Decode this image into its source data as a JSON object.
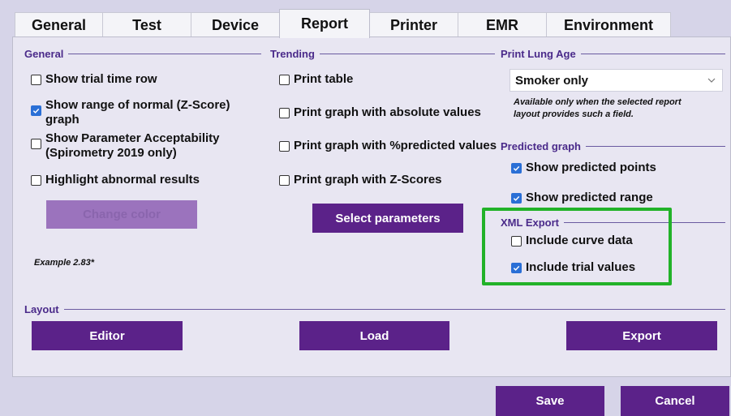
{
  "tabs": [
    {
      "label": "General"
    },
    {
      "label": "Test"
    },
    {
      "label": "Device"
    },
    {
      "label": "Report",
      "active": true
    },
    {
      "label": "Printer"
    },
    {
      "label": "EMR"
    },
    {
      "label": "Environment"
    }
  ],
  "sections": {
    "general": "General",
    "trending": "Trending",
    "print_lung_age": "Print Lung Age",
    "predicted_graph": "Predicted graph",
    "xml_export": "XML Export",
    "layout": "Layout"
  },
  "general": {
    "show_trial_time_row": {
      "label": "Show trial time row",
      "checked": false
    },
    "show_range_of_normal": {
      "label": "Show range of normal (Z-Score) graph",
      "checked": true
    },
    "show_parameter_acceptability": {
      "label": "Show Parameter Acceptability (Spirometry 2019 only)",
      "checked": false
    },
    "highlight_abnormal": {
      "label": "Highlight abnormal results",
      "checked": false
    },
    "change_color_label": "Change color",
    "example_text": "Example 2.83*"
  },
  "trending": {
    "print_table": {
      "label": "Print table",
      "checked": false
    },
    "print_graph_absolute": {
      "label": "Print graph with absolute values",
      "checked": false
    },
    "print_graph_predicted": {
      "label": "Print graph with %predicted values",
      "checked": false
    },
    "print_graph_zscores": {
      "label": "Print graph with Z-Scores",
      "checked": false
    },
    "select_parameters_label": "Select parameters"
  },
  "print_lung_age": {
    "selected": "Smoker only",
    "note": "Available only when the selected report layout provides such a field."
  },
  "predicted_graph": {
    "show_points": {
      "label": "Show predicted points",
      "checked": true
    },
    "show_range": {
      "label": "Show predicted range",
      "checked": true
    }
  },
  "xml_export": {
    "include_curve_data": {
      "label": "Include curve data",
      "checked": false
    },
    "include_trial_values": {
      "label": "Include trial values",
      "checked": true
    }
  },
  "layout": {
    "editor_label": "Editor",
    "load_label": "Load",
    "export_label": "Export"
  },
  "footer": {
    "save_label": "Save",
    "cancel_label": "Cancel"
  },
  "colors": {
    "accent": "#5b2289",
    "checkbox": "#2a6fd6",
    "highlight": "#22b229",
    "section_text": "#4a2a8a"
  }
}
